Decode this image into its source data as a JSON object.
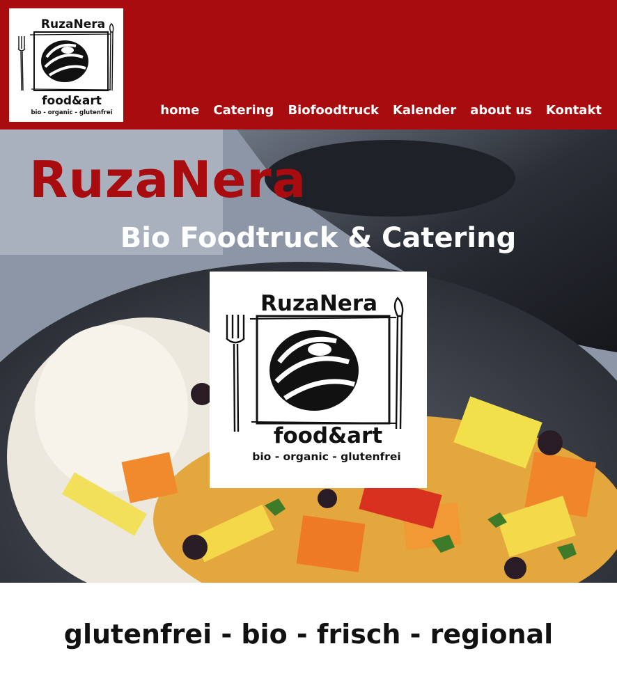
{
  "header": {
    "logo": {
      "brand": "RuzaNera",
      "tagline_main": "food&art",
      "tagline_sub": "bio - organic - glutenfrei"
    },
    "nav": [
      {
        "label": "home"
      },
      {
        "label": "Catering"
      },
      {
        "label": "Biofoodtruck"
      },
      {
        "label": "Kalender"
      },
      {
        "label": "about us"
      },
      {
        "label": "Kontakt"
      }
    ]
  },
  "hero": {
    "title": "RuzaNera",
    "subtitle": "Bio Foodtruck & Catering",
    "logo": {
      "brand": "RuzaNera",
      "tagline_main": "food&art",
      "tagline_sub": "bio - organic - glutenfrei"
    }
  },
  "tagline": "glutenfrei - bio - frisch - regional",
  "colors": {
    "brand_red": "#a80c0f",
    "white": "#ffffff",
    "text_dark": "#111111"
  }
}
